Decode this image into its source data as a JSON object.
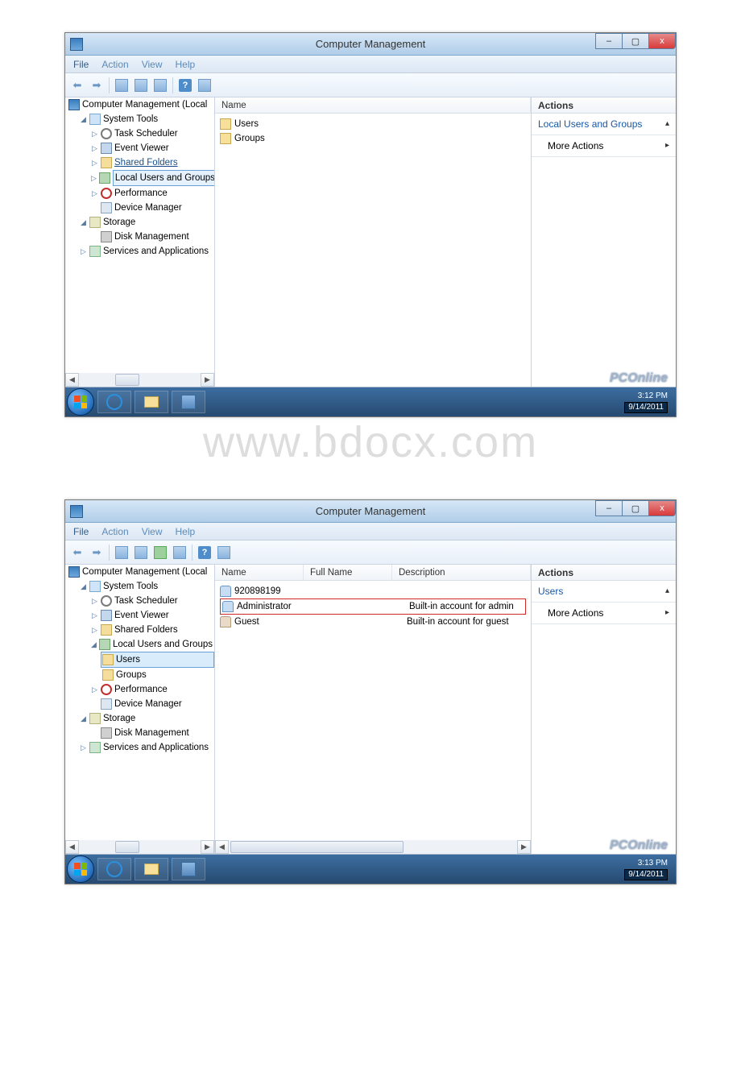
{
  "watermark": "www.bdocx.com",
  "window": {
    "title": "Computer Management",
    "controls": {
      "min": "–",
      "max": "▢",
      "close": "x"
    }
  },
  "menubar": {
    "file": "File",
    "action": "Action",
    "view": "View",
    "help": "Help"
  },
  "tree": {
    "root": "Computer Management (Local",
    "system_tools": "System Tools",
    "task_scheduler": "Task Scheduler",
    "event_viewer": "Event Viewer",
    "shared_folders": "Shared Folders",
    "local_users_groups": "Local Users and Groups",
    "lug_users": "Users",
    "lug_groups": "Groups",
    "performance": "Performance",
    "device_manager": "Device Manager",
    "storage": "Storage",
    "disk_management": "Disk Management",
    "services_apps": "Services and Applications"
  },
  "shot1": {
    "list_headers": {
      "name": "Name"
    },
    "rows": [
      {
        "icon": "folder",
        "name": "Users"
      },
      {
        "icon": "folder",
        "name": "Groups"
      }
    ],
    "actions": {
      "header": "Actions",
      "section": "Local Users and Groups",
      "more": "More Actions"
    },
    "time": "3:12 PM",
    "date": "9/14/2011"
  },
  "shot2": {
    "list_headers": {
      "name": "Name",
      "fullname": "Full Name",
      "description": "Description"
    },
    "rows": [
      {
        "icon": "user",
        "name": "920898199",
        "desc": ""
      },
      {
        "icon": "user",
        "name": "Administrator",
        "desc": "Built-in account for admin",
        "selected": true
      },
      {
        "icon": "userDis",
        "name": "Guest",
        "desc": "Built-in account for guest"
      }
    ],
    "actions": {
      "header": "Actions",
      "section": "Users",
      "more": "More Actions"
    },
    "time": "3:13 PM",
    "date": "9/14/2011"
  },
  "pconline": "PCOnline"
}
